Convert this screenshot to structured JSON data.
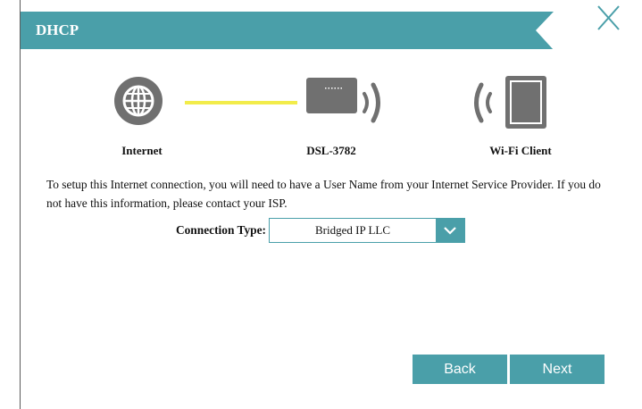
{
  "dialog": {
    "title": "DHCP"
  },
  "diagram": {
    "internet_label": "Internet",
    "router_label": "DSL-3782",
    "client_label": "Wi-Fi Client",
    "link_color": "#f2ec4a",
    "icon_color": "#707070"
  },
  "description": "To setup this Internet connection, you will need to have a User Name from your Internet Service Provider. If you do not have this information, please contact your ISP.",
  "form": {
    "connection_type_label": "Connection Type:",
    "connection_type_value": "Bridged IP LLC"
  },
  "buttons": {
    "back": "Back",
    "next": "Next"
  },
  "colors": {
    "accent": "#4a9fa9"
  }
}
